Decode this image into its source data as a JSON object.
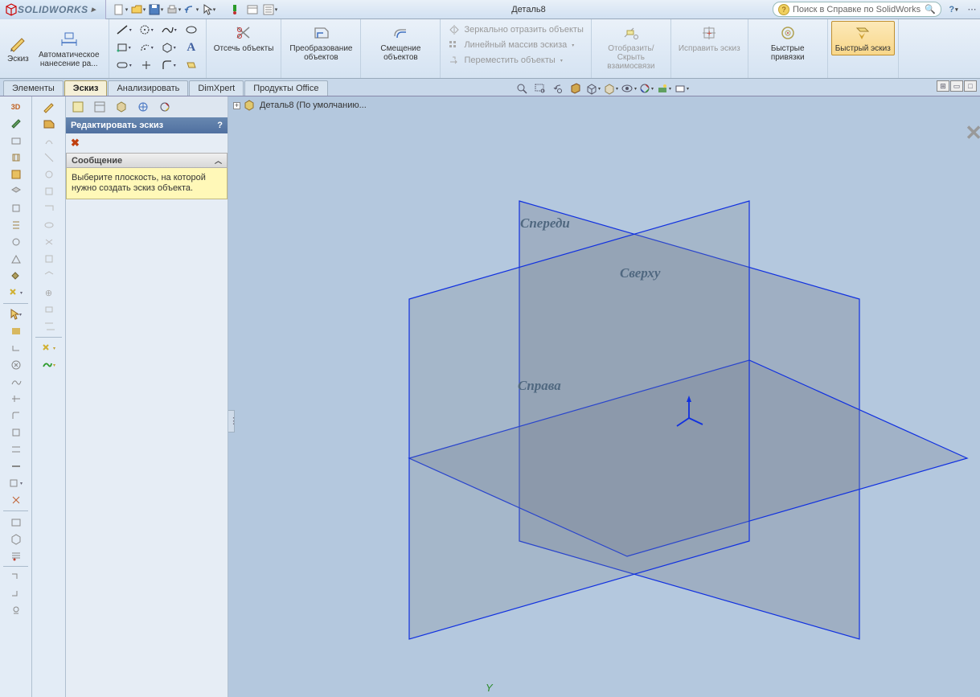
{
  "app_name": "SOLIDWORKS",
  "doc_title": "Деталь8",
  "search_placeholder": "Поиск в Справке по SolidWorks",
  "ribbon": {
    "sketch": "Эскиз",
    "auto_dim": "Автоматическое нанесение ра...",
    "trim": "Отсечь объекты",
    "convert": "Преобразование объектов",
    "offset": "Смещение объектов",
    "mirror": "Зеркально отразить объекты",
    "linear_pattern": "Линейный массив эскиза",
    "move": "Переместить объекты",
    "display_hide": "Отобразить/Скрыть взаимосвязи",
    "repair": "Исправить эскиз",
    "quick_snaps": "Быстрые привязки",
    "rapid_sketch": "Быстрый эскиз"
  },
  "tabs": {
    "features": "Элементы",
    "sketch": "Эскиз",
    "evaluate": "Анализировать",
    "dimxpert": "DimXpert",
    "office": "Продукты Office"
  },
  "panel": {
    "title": "Редактировать эскиз",
    "msg_header": "Сообщение",
    "msg_body": "Выберите плоскость, на которой нужно создать эскиз объекта."
  },
  "viewport": {
    "breadcrumb": "Деталь8  (По умолчанию...",
    "plane_front": "Спереди",
    "plane_top": "Сверху",
    "plane_right": "Справа",
    "axis_y": "Y"
  }
}
